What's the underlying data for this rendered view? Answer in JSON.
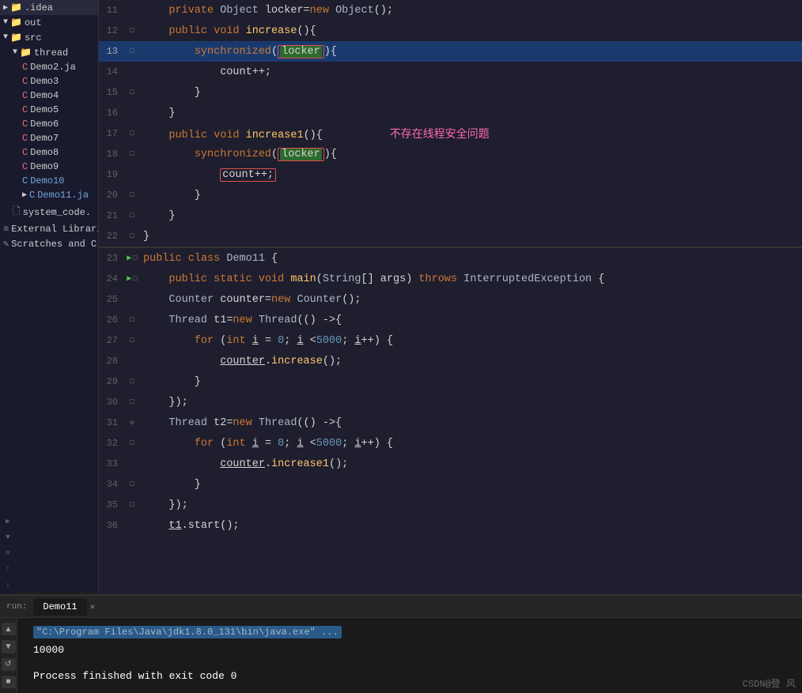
{
  "sidebar": {
    "items": [
      {
        "label": ".idea",
        "type": "folder",
        "indent": 0,
        "expanded": false
      },
      {
        "label": "out",
        "type": "folder",
        "indent": 0,
        "expanded": true,
        "selected": false
      },
      {
        "label": "src",
        "type": "folder",
        "indent": 0,
        "expanded": true
      },
      {
        "label": "thread",
        "type": "folder",
        "indent": 1,
        "expanded": true
      },
      {
        "label": "Demo2.ja",
        "type": "java",
        "indent": 2
      },
      {
        "label": "Demo3",
        "type": "java-c",
        "indent": 2
      },
      {
        "label": "Demo4",
        "type": "java-c",
        "indent": 2
      },
      {
        "label": "Demo5",
        "type": "java-c",
        "indent": 2
      },
      {
        "label": "Demo6",
        "type": "java-c",
        "indent": 2
      },
      {
        "label": "Demo7",
        "type": "java-c",
        "indent": 2
      },
      {
        "label": "Demo8",
        "type": "java-c",
        "indent": 2
      },
      {
        "label": "Demo9",
        "type": "java-c",
        "indent": 2
      },
      {
        "label": "Demo10",
        "type": "java-c-blue",
        "indent": 2
      },
      {
        "label": "Demo11.ja",
        "type": "java-c-blue",
        "indent": 2,
        "expanded": false
      },
      {
        "label": "system_code.",
        "type": "file",
        "indent": 1
      },
      {
        "label": "External Librarie",
        "type": "lib",
        "indent": 0
      },
      {
        "label": "Scratches and C",
        "type": "scratch",
        "indent": 0
      }
    ]
  },
  "editor": {
    "lines": [
      {
        "num": 11,
        "content_type": "normal",
        "gutter": "",
        "code": "    private Object locker=new Object();"
      },
      {
        "num": 12,
        "content_type": "normal",
        "gutter": "",
        "code": "    public void increase(){"
      },
      {
        "num": 13,
        "content_type": "highlighted",
        "gutter": "",
        "code": "        synchronized(locker){"
      },
      {
        "num": 14,
        "content_type": "normal",
        "gutter": "",
        "code": "            count++;"
      },
      {
        "num": 15,
        "content_type": "normal",
        "gutter": "",
        "code": "        }"
      },
      {
        "num": 16,
        "content_type": "normal",
        "gutter": "",
        "code": "    }"
      },
      {
        "num": 17,
        "content_type": "normal",
        "gutter": "",
        "code": "    public void increase1(){"
      },
      {
        "num": 18,
        "content_type": "normal",
        "gutter": "",
        "code": "        synchronized(locker){"
      },
      {
        "num": 19,
        "content_type": "normal",
        "gutter": "",
        "code": "            count++;"
      },
      {
        "num": 20,
        "content_type": "normal",
        "gutter": "",
        "code": "        }"
      },
      {
        "num": 21,
        "content_type": "normal",
        "gutter": "",
        "code": "    }"
      },
      {
        "num": 22,
        "content_type": "normal",
        "gutter": "",
        "code": "}"
      },
      {
        "num": 23,
        "content_type": "run",
        "gutter": "run",
        "code": "public class Demo11 {"
      },
      {
        "num": 24,
        "content_type": "run",
        "gutter": "run",
        "code": "    public static void main(String[] args) throws InterruptedException {"
      },
      {
        "num": 25,
        "content_type": "normal",
        "gutter": "",
        "code": "    Counter counter=new Counter();"
      },
      {
        "num": 26,
        "content_type": "normal",
        "gutter": "",
        "code": "    Thread t1=new Thread(() ->{"
      },
      {
        "num": 27,
        "content_type": "normal",
        "gutter": "",
        "code": "        for (int i = 0; i <5000; i++) {"
      },
      {
        "num": 28,
        "content_type": "normal",
        "gutter": "",
        "code": "            counter.increase();"
      },
      {
        "num": 29,
        "content_type": "normal",
        "gutter": "",
        "code": "        }"
      },
      {
        "num": 30,
        "content_type": "normal",
        "gutter": "",
        "code": "    });"
      },
      {
        "num": 31,
        "content_type": "normal",
        "gutter": "",
        "code": "    Thread t2=new Thread(() ->{"
      },
      {
        "num": 32,
        "content_type": "normal",
        "gutter": "",
        "code": "        for (int i = 0; i <5000; i++) {"
      },
      {
        "num": 33,
        "content_type": "normal",
        "gutter": "",
        "code": "            counter.increase1();"
      },
      {
        "num": 34,
        "content_type": "normal",
        "gutter": "",
        "code": "        }"
      },
      {
        "num": 35,
        "content_type": "normal",
        "gutter": "",
        "code": "    });"
      },
      {
        "num": 36,
        "content_type": "normal",
        "gutter": "",
        "code": "    t1.start();"
      }
    ]
  },
  "bottom_panel": {
    "tab_label": "Demo11",
    "console_path": "\"C:\\Program Files\\Java\\jdk1.8.0_131\\bin\\java.exe\" ...",
    "output_value": "10000",
    "process_done": "Process finished with exit code 0"
  },
  "annotation": {
    "text": "不存在线程安全问题"
  },
  "watermark": "CSDN@登 风"
}
